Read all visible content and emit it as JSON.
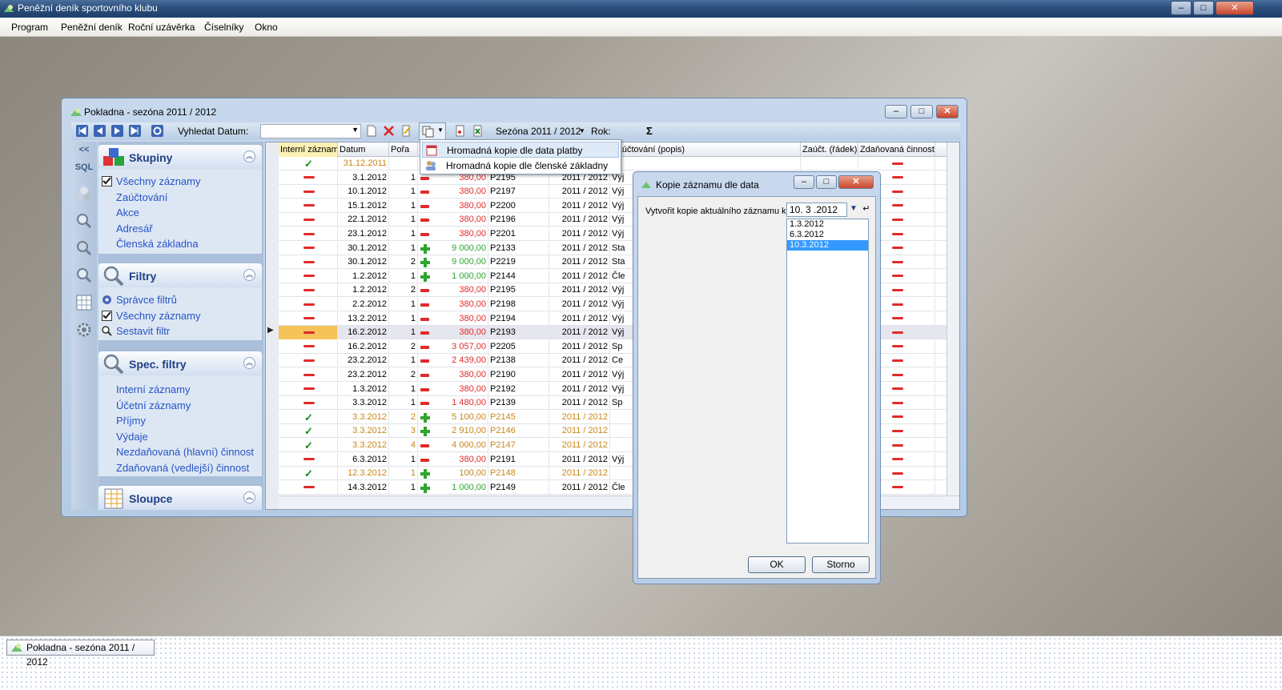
{
  "app": {
    "title": "Peněžní deník sportovního klubu",
    "window_controls": [
      "–",
      "□",
      "✕"
    ]
  },
  "menu": [
    "Program",
    "Peněžní deník",
    "Roční uzávěrka",
    "Číselníky",
    "Okno"
  ],
  "child": {
    "title": "Pokladna - sezóna 2011 / 2012",
    "toolbar": {
      "search_label": "Vyhledat Datum:",
      "season": "Sezóna 2011 / 2012",
      "year_label": "Rok:",
      "sum_symbol": "Σ"
    }
  },
  "sidebar": {
    "strip": [
      "<<",
      "SQL"
    ],
    "groups": [
      {
        "title": "Skupiny",
        "items": [
          "Všechny záznamy",
          "Zaúčtování",
          "Akce",
          "Adresář",
          "Členská základna"
        ]
      },
      {
        "title": "Filtry",
        "items": [
          "Správce filtrů",
          "Všechny záznamy",
          "Sestavit filtr"
        ]
      },
      {
        "title": "Spec. filtry",
        "items": [
          "Interní záznamy",
          "Účetní záznamy",
          "Příjmy",
          "Výdaje",
          "Nezdaňovaná (hlavní) činnost",
          "Zdaňovaná (vedlejší) činnost"
        ]
      },
      {
        "title": "Sloupce",
        "items": []
      }
    ]
  },
  "grid": {
    "columns": [
      "Interní záznam",
      "Datum",
      "Pořa",
      "",
      "",
      "",
      "",
      "Zaúčtování (popis)",
      "Zaúčt. (řádek)",
      "Zdaňovaná činnost"
    ],
    "rows": [
      {
        "int": true,
        "date": "31.12.2011",
        "por": "",
        "sign": "",
        "amount": "",
        "doc": "",
        "season": "",
        "desc": "",
        "orange": true
      },
      {
        "int": false,
        "date": "3.1.2012",
        "por": "1",
        "sign": "-",
        "amount": "380,00",
        "doc": "P2195",
        "season": "2011 / 2012",
        "desc": "Výj"
      },
      {
        "int": false,
        "date": "10.1.2012",
        "por": "1",
        "sign": "-",
        "amount": "380,00",
        "doc": "P2197",
        "season": "2011 / 2012",
        "desc": "Výj"
      },
      {
        "int": false,
        "date": "15.1.2012",
        "por": "1",
        "sign": "-",
        "amount": "380,00",
        "doc": "P2200",
        "season": "2011 / 2012",
        "desc": "Výj"
      },
      {
        "int": false,
        "date": "22.1.2012",
        "por": "1",
        "sign": "-",
        "amount": "380,00",
        "doc": "P2196",
        "season": "2011 / 2012",
        "desc": "Výj"
      },
      {
        "int": false,
        "date": "23.1.2012",
        "por": "1",
        "sign": "-",
        "amount": "380,00",
        "doc": "P2201",
        "season": "2011 / 2012",
        "desc": "Výj"
      },
      {
        "int": false,
        "date": "30.1.2012",
        "por": "1",
        "sign": "+",
        "amount": "9 000,00",
        "doc": "P2133",
        "season": "2011 / 2012",
        "desc": "Sta"
      },
      {
        "int": false,
        "date": "30.1.2012",
        "por": "2",
        "sign": "+",
        "amount": "9 000,00",
        "doc": "P2219",
        "season": "2011 / 2012",
        "desc": "Sta"
      },
      {
        "int": false,
        "date": "1.2.2012",
        "por": "1",
        "sign": "+",
        "amount": "1 000,00",
        "doc": "P2144",
        "season": "2011 / 2012",
        "desc": "Čle"
      },
      {
        "int": false,
        "date": "1.2.2012",
        "por": "2",
        "sign": "-",
        "amount": "380,00",
        "doc": "P2195",
        "season": "2011 / 2012",
        "desc": "Výj"
      },
      {
        "int": false,
        "date": "2.2.2012",
        "por": "1",
        "sign": "-",
        "amount": "380,00",
        "doc": "P2198",
        "season": "2011 / 2012",
        "desc": "Výj"
      },
      {
        "int": false,
        "date": "13.2.2012",
        "por": "1",
        "sign": "-",
        "amount": "380,00",
        "doc": "P2194",
        "season": "2011 / 2012",
        "desc": "Výj"
      },
      {
        "int": false,
        "date": "16.2.2012",
        "por": "1",
        "sign": "-",
        "amount": "380,00",
        "doc": "P2193",
        "season": "2011 / 2012",
        "desc": "Výj",
        "selected": true
      },
      {
        "int": false,
        "date": "16.2.2012",
        "por": "2",
        "sign": "-",
        "amount": "3 057,00",
        "doc": "P2205",
        "season": "2011 / 2012",
        "desc": "Sp"
      },
      {
        "int": false,
        "date": "23.2.2012",
        "por": "1",
        "sign": "-",
        "amount": "2 439,00",
        "doc": "P2138",
        "season": "2011 / 2012",
        "desc": "Ce"
      },
      {
        "int": false,
        "date": "23.2.2012",
        "por": "2",
        "sign": "-",
        "amount": "380,00",
        "doc": "P2190",
        "season": "2011 / 2012",
        "desc": "Výj"
      },
      {
        "int": false,
        "date": "1.3.2012",
        "por": "1",
        "sign": "-",
        "amount": "380,00",
        "doc": "P2192",
        "season": "2011 / 2012",
        "desc": "Výj"
      },
      {
        "int": false,
        "date": "3.3.2012",
        "por": "1",
        "sign": "-",
        "amount": "1 480,00",
        "doc": "P2139",
        "season": "2011 / 2012",
        "desc": "Sp"
      },
      {
        "int": true,
        "date": "3.3.2012",
        "por": "2",
        "sign": "+",
        "amount": "5 100,00",
        "doc": "P2145",
        "season": "2011 / 2012",
        "desc": "",
        "orange": true
      },
      {
        "int": true,
        "date": "3.3.2012",
        "por": "3",
        "sign": "+",
        "amount": "2 910,00",
        "doc": "P2146",
        "season": "2011 / 2012",
        "desc": "",
        "orange": true
      },
      {
        "int": true,
        "date": "3.3.2012",
        "por": "4",
        "sign": "-",
        "amount": "4 000,00",
        "doc": "P2147",
        "season": "2011 / 2012",
        "desc": "",
        "orange": true
      },
      {
        "int": false,
        "date": "6.3.2012",
        "por": "1",
        "sign": "-",
        "amount": "380,00",
        "doc": "P2191",
        "season": "2011 / 2012",
        "desc": "Výj"
      },
      {
        "int": true,
        "date": "12.3.2012",
        "por": "1",
        "sign": "+",
        "amount": "100,00",
        "doc": "P2148",
        "season": "2011 / 2012",
        "desc": "",
        "orange": true
      },
      {
        "int": false,
        "date": "14.3.2012",
        "por": "1",
        "sign": "+",
        "amount": "1 000,00",
        "doc": "P2149",
        "season": "2011 / 2012",
        "desc": "Čle"
      }
    ]
  },
  "dropdown": {
    "items": [
      "Hromadná kopie dle data platby",
      "Hromadná kopie dle členské základny"
    ]
  },
  "dialog": {
    "title": "Kopie záznamu dle data",
    "label": "Vytvořit kopie aktuálního záznamu k:",
    "date_value": "10. 3 .2012",
    "dates": [
      "1.3.2012",
      "6.3.2012",
      "10.3.2012"
    ],
    "selected_index": 2,
    "ok": "OK",
    "cancel": "Storno"
  },
  "taskbar": {
    "item": "Pokladna - sezóna 2011 / 2012"
  },
  "colors": {
    "red": "#e02a2a",
    "green": "#2ea52e",
    "orange": "#c8861a",
    "link": "#2653c6"
  }
}
